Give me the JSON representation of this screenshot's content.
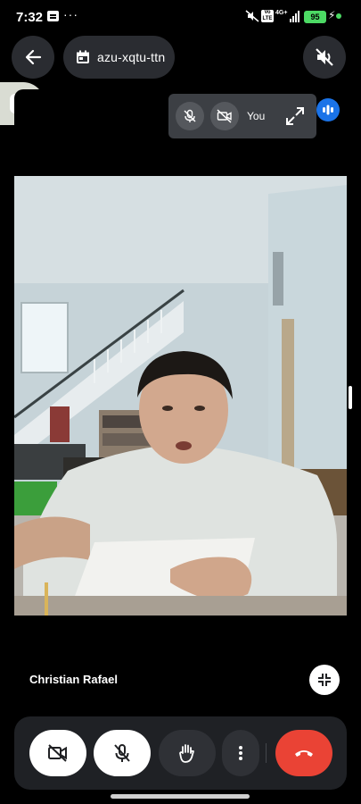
{
  "status_bar": {
    "time": "7:32",
    "dots": "···",
    "network": "4G+",
    "volte": "Vo LTE",
    "battery": "95"
  },
  "header": {
    "meeting_code": "azu-xqtu-ttn"
  },
  "self_view": {
    "label": "You"
  },
  "participant": {
    "name": "Christian Rafael"
  },
  "icons": {
    "back": "arrow-left-icon",
    "calendar": "calendar-icon",
    "speaker_off": "speaker-off-icon",
    "mic_off": "mic-off-icon",
    "camera_off": "camera-off-icon",
    "expand": "expand-icon",
    "shrink": "shrink-icon",
    "hand": "raise-hand-icon",
    "more": "more-vert-icon",
    "end_call": "end-call-icon"
  },
  "colors": {
    "end_call": "#ea4335",
    "speaking": "#1a73e8",
    "battery": "#4cd964"
  }
}
